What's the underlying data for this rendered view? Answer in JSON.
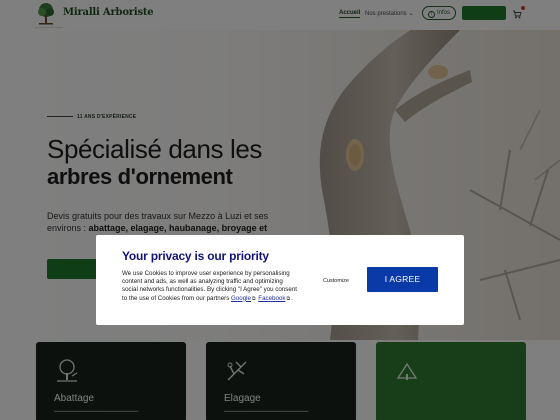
{
  "header": {
    "logo_text": "Miralli Arboriste",
    "nav": [
      {
        "label": "Accueil"
      },
      {
        "label": "Nos prestations"
      }
    ],
    "infos_label": "Infos"
  },
  "hero": {
    "kicker": "11 ANS D'EXPÉRIENCE",
    "title_line1": "Spécialisé dans les",
    "title_line2": "arbres d'ornement",
    "desc_prefix": "Devis gratuits pour des travaux sur Mezzo à Luzi et ses environs : ",
    "desc_bold": "abattage, elagage, haubanage, broyage et"
  },
  "cards": [
    {
      "label": "Abattage",
      "icon": "tree-felling-icon"
    },
    {
      "label": "Elagage",
      "icon": "pruning-icon"
    },
    {
      "label": "",
      "icon": "service-icon"
    }
  ],
  "privacy": {
    "title": "Your privacy is our priority",
    "text_part1": "We use Cookies to improve user experience by personalising content and ads, as well as analyzing traffic and optimizing social networks functionalities. By clicking \"I Agree\" you consent to the use of Cookies from our partners ",
    "link_google": "Google",
    "link_facebook": "Facebook",
    "text_end": ".",
    "customize_label": "Customize",
    "agree_label": "I AGREE"
  },
  "colors": {
    "brand_green": "#1f7a2a",
    "modal_title": "#13137a",
    "agree_button": "#0a3aa8"
  }
}
